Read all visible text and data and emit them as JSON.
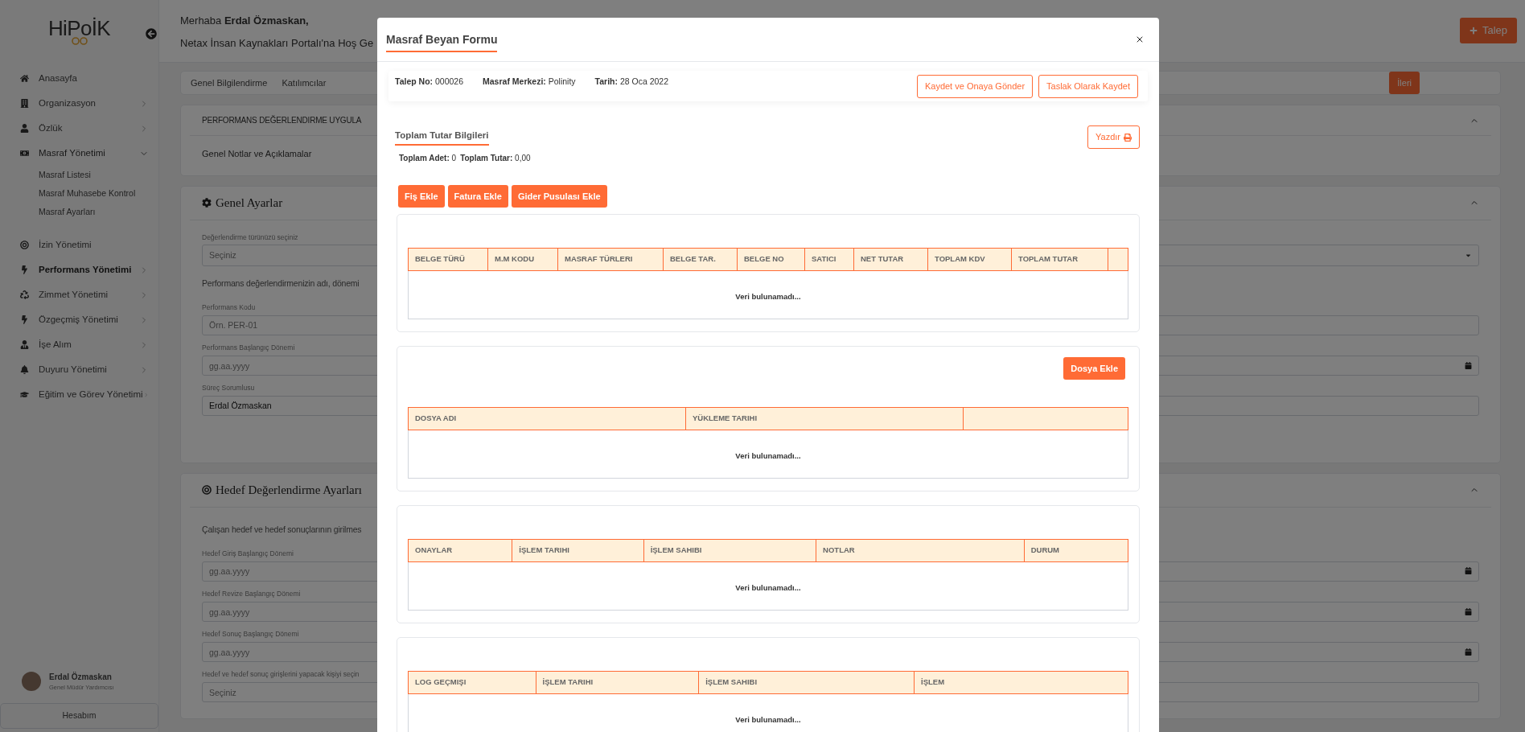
{
  "sidebar": {
    "logo": "HiPoİK",
    "nav": [
      {
        "label": "Anasayfa",
        "has_submenu": false,
        "selected": false
      },
      {
        "label": "Organizasyon",
        "has_submenu": true,
        "expanded": false,
        "selected": false
      },
      {
        "label": "Özlük",
        "has_submenu": true,
        "expanded": false,
        "selected": false
      },
      {
        "label": "Masraf Yönetimi",
        "has_submenu": true,
        "expanded": true,
        "selected": false,
        "children": [
          {
            "label": "Masraf Listesi"
          },
          {
            "label": "Masraf Muhasebe Kontrol"
          },
          {
            "label": "Masraf Ayarları"
          }
        ]
      },
      {
        "label": "İzin Yönetimi",
        "has_submenu": false,
        "selected": false
      },
      {
        "label": "Performans Yönetimi",
        "has_submenu": true,
        "expanded": false,
        "selected": true
      },
      {
        "label": "Zimmet Yönetimi",
        "has_submenu": true,
        "expanded": false,
        "selected": false
      },
      {
        "label": "Özgeçmiş Yönetimi",
        "has_submenu": true,
        "expanded": false,
        "selected": false
      },
      {
        "label": "İşe Alım",
        "has_submenu": true,
        "expanded": false,
        "selected": false
      },
      {
        "label": "Duyuru Yönetimi",
        "has_submenu": true,
        "expanded": false,
        "selected": false
      },
      {
        "label": "Eğitim ve Görev Yönetimi",
        "has_submenu": true,
        "expanded": false,
        "selected": false
      }
    ],
    "user": {
      "name": "Erdal Özmaskan",
      "title": "Genel Müdür Yardımcısı"
    },
    "account_button": "Hesabım"
  },
  "header": {
    "greeting": "Merhaba **Erdal Özmaskan,**",
    "welcome": "Netax İnsan Kaynakları Portalı'na Hoş Ge",
    "new_button": "Talep"
  },
  "tabs": [
    {
      "label": "Genel Bilgilendirme",
      "selected": false
    },
    {
      "label": "Katılımcılar",
      "selected": false
    }
  ],
  "next_button": "İleri",
  "info_card": {
    "title": "PERFORMANS DEĞERLENDIRME UYGULA",
    "notes": "Genel Notlar ve Açıklamalar",
    "expanded": true
  },
  "sections": [
    {
      "title": "Genel Ayarlar",
      "expanded": true,
      "items": [
        {
          "kind": "select",
          "label": "Değerlendirme türünüzü seçiniz",
          "placeholder": "Seçiniz"
        },
        {
          "kind": "text",
          "text": "Performans değerlendirmenizin adı, dönemi"
        },
        {
          "kind": "input",
          "label": "Performans Kodu",
          "placeholder": "Örn. PER-01"
        },
        {
          "kind": "date",
          "label": "Performans Başlangıç Dönemi",
          "placeholder": "gg.aa.yyyy"
        },
        {
          "kind": "input",
          "label": "Süreç Sorumlusu",
          "value": "Erdal Özmaskan"
        }
      ]
    },
    {
      "title": "Hedef Değerlendirme Ayarları",
      "expanded": true,
      "items": [
        {
          "kind": "text",
          "text": "Çalışan hedef ve hedef sonuçlarının girilmes"
        },
        {
          "kind": "date",
          "label": "Hedef Giriş Başlangıç Dönemi",
          "placeholder": "gg.aa.yyyy"
        },
        {
          "kind": "date",
          "label": "Hedef Revize Başlangıç Dönemi",
          "placeholder": "gg.aa.yyyy"
        },
        {
          "kind": "date",
          "label": "Hedef Sonuç Başlangıç Dönemi",
          "placeholder": "gg.aa.yyyy"
        },
        {
          "kind": "input",
          "label": "Hedef ve hedef sonuç girişlerini yapacak kişiyi seçin",
          "placeholder": "Seçiniz"
        }
      ]
    }
  ],
  "modal": {
    "title": "Masraf Beyan Formu",
    "request": [
      {
        "label": "Talep No:",
        "value": "000026"
      },
      {
        "label": "Masraf Merkezi:",
        "value": "Polinity"
      },
      {
        "label": "Tarih:",
        "value": "28 Oca 2022"
      }
    ],
    "actions": [
      "Kaydet ve Onaya Gönder",
      "Taslak Olarak Kaydet"
    ],
    "totals_title": "Toplam Tutar Bilgileri",
    "print_button": "Yazdır",
    "totals": [
      {
        "label": "Toplam Adet:",
        "value": "0"
      },
      {
        "label": "Toplam Tutar:",
        "value": "0,00"
      }
    ],
    "add_buttons": [
      "Fiş Ekle",
      "Fatura Ekle",
      "Gider Pusulası Ekle"
    ],
    "tables": [
      {
        "columns": [
          "BELGE TÜRÜ",
          "M.M KODU",
          "MASRAF TÜRLERI",
          "BELGE TAR.",
          "BELGE NO",
          "SATICI",
          "NET TUTAR",
          "TOPLAM KDV",
          "TOPLAM TUTAR"
        ],
        "trailing_empty_column": true,
        "empty_text": "Veri bulunamadı..."
      },
      {
        "action_button": "Dosya Ekle",
        "columns": [
          "DOSYA ADI",
          "YÜKLEME TARIHI"
        ],
        "trailing_empty_column": true,
        "empty_text": "Veri bulunamadı..."
      },
      {
        "columns": [
          "ONAYLAR",
          "İŞLEM TARIHI",
          "İŞLEM SAHIBI",
          "NOTLAR",
          "DURUM"
        ],
        "trailing_empty_column": false,
        "empty_text": "Veri bulunamadı..."
      },
      {
        "columns": [
          "LOG GEÇMIŞI",
          "İŞLEM TARIHI",
          "İŞLEM SAHIBI",
          "İŞLEM"
        ],
        "trailing_empty_column": false,
        "empty_text": "Veri bulunamadı..."
      }
    ]
  }
}
